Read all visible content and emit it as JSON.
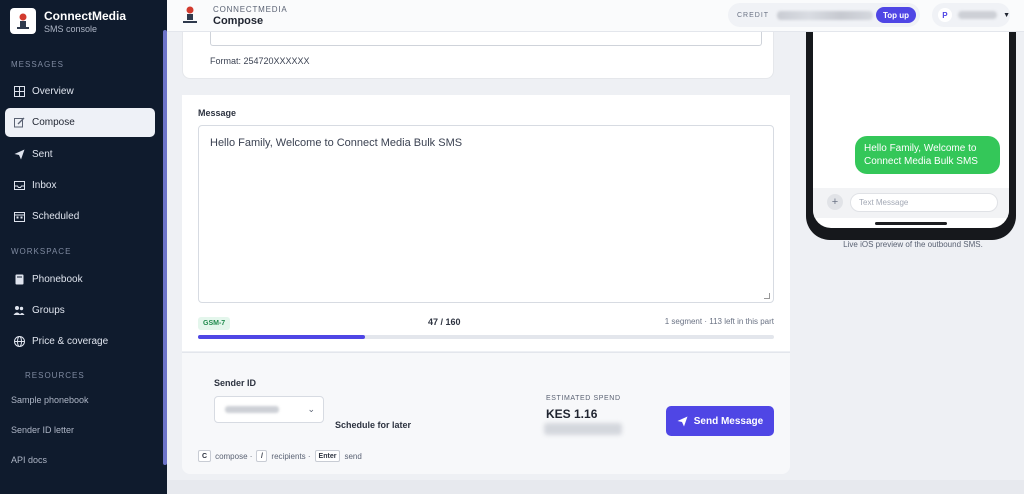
{
  "sidebar": {
    "brand_name": "ConnectMedia",
    "brand_sub": "SMS console",
    "section_messages": "MESSAGES",
    "section_workspace": "WORKSPACE",
    "section_resources": "RESOURCES",
    "items": [
      {
        "label": "Overview",
        "icon": "grid-icon"
      },
      {
        "label": "Compose",
        "icon": "edit-icon"
      },
      {
        "label": "Sent",
        "icon": "send-icon"
      },
      {
        "label": "Inbox",
        "icon": "inbox-icon"
      },
      {
        "label": "Scheduled",
        "icon": "calendar-icon"
      },
      {
        "label": "Phonebook",
        "icon": "book-icon"
      },
      {
        "label": "Groups",
        "icon": "users-icon"
      },
      {
        "label": "Price & coverage",
        "icon": "globe-icon"
      }
    ],
    "resources": [
      "Sample phonebook",
      "Sender ID letter",
      "API docs"
    ]
  },
  "topbar": {
    "org_label": "CONNECTMEDIA",
    "page_title": "Compose",
    "credit_label": "CREDIT",
    "topup_label": "Top up",
    "user_initial": "P"
  },
  "recipients": {
    "format_hint": "Format: 254720XXXXXX"
  },
  "message": {
    "label": "Message",
    "text": "Hello Family, Welcome to Connect Media Bulk SMS",
    "encoding": "GSM-7",
    "char_count": "47 / 160",
    "segment_info": "1 segment · 113 left in this part",
    "progress_fraction": 0.29
  },
  "sender": {
    "label": "Sender ID",
    "schedule_label": "Schedule for later"
  },
  "estimate": {
    "label": "ESTIMATED SPEND",
    "value": "KES 1.16"
  },
  "send_button": "Send Message",
  "shortcuts": [
    {
      "key": "C",
      "text": "compose ·"
    },
    {
      "key": "/",
      "text": "recipients ·"
    },
    {
      "key": "Enter",
      "text": "send"
    }
  ],
  "preview": {
    "bubble_text": "Hello Family, Welcome to Connect Media Bulk SMS",
    "input_placeholder": "Text Message",
    "caption": "Live iOS preview of the outbound SMS."
  },
  "colors": {
    "sidebar_bg": "#0f1b2d",
    "accent": "#4f46e5",
    "imessage_green": "#34c759",
    "gsm_badge": "#1f8a4c"
  }
}
